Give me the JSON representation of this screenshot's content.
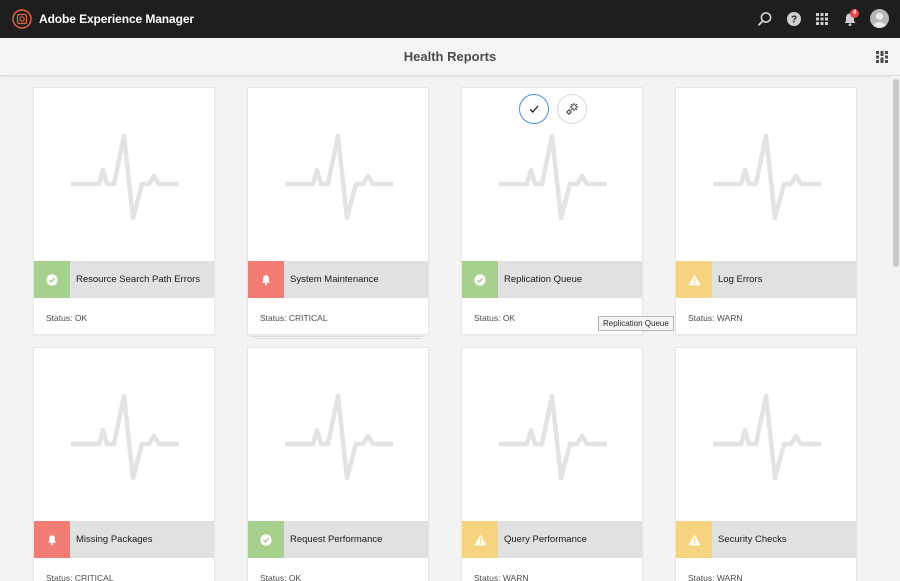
{
  "shell": {
    "app_title": "Adobe Experience Manager",
    "notification_count": "4",
    "icons": [
      "search-icon",
      "help-icon",
      "solutions-grid-icon",
      "notifications-bell-icon",
      "user-avatar"
    ]
  },
  "page": {
    "title": "Health Reports",
    "view_switch_icon": "card-view-icon"
  },
  "colors": {
    "ok": "#a7d08f",
    "critical": "#f27b73",
    "warn": "#f6d37f",
    "shell_bg": "#1e1e1e",
    "accent": "#4b8fd8"
  },
  "cards": [
    {
      "title": "Resource Search Path Errors",
      "status_text": "Status: OK",
      "state": "ok",
      "icon": "checkmark-icon"
    },
    {
      "title": "System Maintenance",
      "status_text": "Status: CRITICAL",
      "state": "critical",
      "icon": "bell-icon"
    },
    {
      "title": "Replication Queue",
      "status_text": "Status: OK",
      "state": "ok",
      "icon": "checkmark-icon"
    },
    {
      "title": "Log Errors",
      "status_text": "Status: WARN",
      "state": "warn",
      "icon": "alert-icon"
    },
    {
      "title": "Missing Packages",
      "status_text": "Status: CRITICAL",
      "state": "critical",
      "icon": "bell-icon"
    },
    {
      "title": "Request Performance",
      "status_text": "Status: OK",
      "state": "ok",
      "icon": "checkmark-icon"
    },
    {
      "title": "Query Performance",
      "status_text": "Status: WARN",
      "state": "warn",
      "icon": "alert-icon"
    },
    {
      "title": "Security Checks",
      "status_text": "Status: WARN",
      "state": "warn",
      "icon": "alert-icon"
    }
  ],
  "quick_actions": {
    "select_icon": "checkmark-icon",
    "configure_icon": "gears-icon"
  },
  "tooltip": {
    "text": "Replication Queue"
  }
}
